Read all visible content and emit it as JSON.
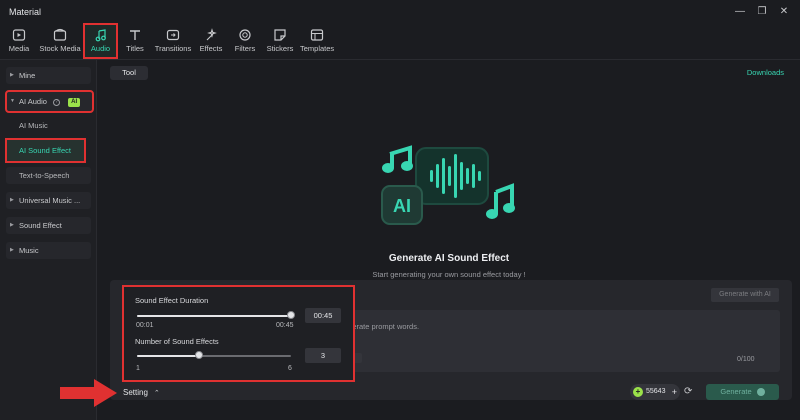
{
  "window": {
    "title": "Material",
    "controls": [
      "minimize",
      "restore",
      "close"
    ]
  },
  "toolbar": {
    "items": [
      {
        "label": "Media",
        "icon": "media-icon"
      },
      {
        "label": "Stock Media",
        "icon": "stock-media-icon"
      },
      {
        "label": "Audio",
        "icon": "audio-note-icon",
        "active": true
      },
      {
        "label": "Titles",
        "icon": "titles-icon"
      },
      {
        "label": "Transitions",
        "icon": "transitions-icon"
      },
      {
        "label": "Effects",
        "icon": "effects-icon"
      },
      {
        "label": "Filters",
        "icon": "filters-icon"
      },
      {
        "label": "Stickers",
        "icon": "stickers-icon"
      },
      {
        "label": "Templates",
        "icon": "templates-icon"
      }
    ]
  },
  "sidebar": {
    "mine": "Mine",
    "ai_audio": "AI Audio",
    "ai_badge": "AI",
    "ai_music": "AI Music",
    "ai_sound_effect": "AI Sound Effect",
    "text_to_speech": "Text-to-Speech",
    "universal_music": "Universal Music ...",
    "sound_effect": "Sound Effect",
    "music": "Music"
  },
  "main": {
    "tab_tool": "Tool",
    "downloads": "Downloads",
    "hero_title": "Generate AI Sound Effect",
    "hero_subtitle": "Start generating your own sound effect today !",
    "hero_logo_text": "AI"
  },
  "prompt": {
    "generate_with_ai": "Generate with AI",
    "placeholder_fragment": "enerate prompt words.",
    "counter": "0/100"
  },
  "settings": {
    "duration_label": "Sound Effect Duration",
    "duration_value": "00:45",
    "duration_min": "00:01",
    "duration_max": "00:45",
    "duration_fraction": 1.0,
    "count_label": "Number of Sound Effects",
    "count_value": "3",
    "count_min": "1",
    "count_max": "6",
    "count_fraction": 0.4,
    "toggle_label": "Setting"
  },
  "footer": {
    "credits": "55643",
    "generate_label": "Generate"
  },
  "colors": {
    "accent": "#38d6b2",
    "highlight": "#e03131",
    "badge": "#9be24a"
  }
}
